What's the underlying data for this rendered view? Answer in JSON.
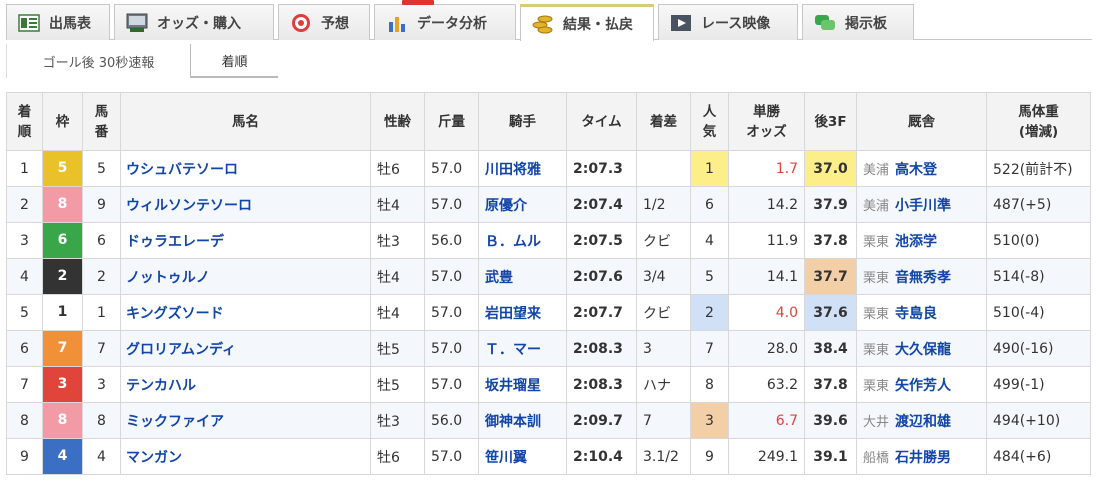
{
  "tabs": [
    {
      "label": "出馬表",
      "icon": "race-card-icon"
    },
    {
      "label": "オッズ・購入",
      "icon": "ipat-terminal-icon"
    },
    {
      "label": "予想",
      "icon": "target-icon"
    },
    {
      "label": "データ分析",
      "icon": "bar-chart-icon"
    },
    {
      "label": "結果・払戻",
      "icon": "coins-icon"
    },
    {
      "label": "レース映像",
      "icon": "video-play-icon"
    },
    {
      "label": "掲示板",
      "icon": "chat-bubble-icon"
    }
  ],
  "subtabs": [
    {
      "label": "ゴール後 30秒速報"
    },
    {
      "label": "着順"
    }
  ],
  "headers": {
    "rank": "着\n順",
    "waku": "枠",
    "umaban": "馬\n番",
    "name": "馬名",
    "sexage": "性齢",
    "weight": "斤量",
    "jockey": "騎手",
    "time": "タイム",
    "margin": "着差",
    "pop": "人\n気",
    "odds": "単勝\nオッズ",
    "last3f": "後3F",
    "trainer": "厩舎",
    "bodyweight": "馬体重\n(増減)"
  },
  "colors": {
    "waku1": "#ffffff",
    "waku2": "#333333",
    "waku3": "#e0443b",
    "waku4": "#3a6fc4",
    "waku5": "#e8c228",
    "waku6": "#3aa64a",
    "waku7": "#f0913a",
    "waku8": "#f29aa6"
  },
  "rows": [
    {
      "rank": "1",
      "waku": "5",
      "umaban": "5",
      "name": "ウシュバテソーロ",
      "sexage": "牡6",
      "weight": "57.0",
      "jockey": "川田将雅",
      "time": "2:07.3",
      "margin": "",
      "pop": "1",
      "odds": "1.7",
      "last3f": "37.0",
      "aff": "美浦",
      "trainer": "高木登",
      "bodyweight": "522(前計不)"
    },
    {
      "rank": "2",
      "waku": "8",
      "umaban": "9",
      "name": "ウィルソンテソーロ",
      "sexage": "牡4",
      "weight": "57.0",
      "jockey": "原優介",
      "time": "2:07.4",
      "margin": "1/2",
      "pop": "6",
      "odds": "14.2",
      "last3f": "37.9",
      "aff": "美浦",
      "trainer": "小手川準",
      "bodyweight": "487(+5)"
    },
    {
      "rank": "3",
      "waku": "6",
      "umaban": "6",
      "name": "ドゥラエレーデ",
      "sexage": "牡3",
      "weight": "56.0",
      "jockey": "Ｂ．ムル",
      "time": "2:07.5",
      "margin": "クビ",
      "pop": "4",
      "odds": "11.9",
      "last3f": "37.8",
      "aff": "栗東",
      "trainer": "池添学",
      "bodyweight": "510(0)"
    },
    {
      "rank": "4",
      "waku": "2",
      "umaban": "2",
      "name": "ノットゥルノ",
      "sexage": "牡4",
      "weight": "57.0",
      "jockey": "武豊",
      "time": "2:07.6",
      "margin": "3/4",
      "pop": "5",
      "odds": "14.1",
      "last3f": "37.7",
      "aff": "栗東",
      "trainer": "音無秀孝",
      "bodyweight": "514(-8)"
    },
    {
      "rank": "5",
      "waku": "1",
      "umaban": "1",
      "name": "キングズソード",
      "sexage": "牡4",
      "weight": "57.0",
      "jockey": "岩田望来",
      "time": "2:07.7",
      "margin": "クビ",
      "pop": "2",
      "odds": "4.0",
      "last3f": "37.6",
      "aff": "栗東",
      "trainer": "寺島良",
      "bodyweight": "510(-4)"
    },
    {
      "rank": "6",
      "waku": "7",
      "umaban": "7",
      "name": "グロリアムンディ",
      "sexage": "牡5",
      "weight": "57.0",
      "jockey": "Ｔ．マー",
      "time": "2:08.3",
      "margin": "3",
      "pop": "7",
      "odds": "28.0",
      "last3f": "38.4",
      "aff": "栗東",
      "trainer": "大久保龍",
      "bodyweight": "490(-16)"
    },
    {
      "rank": "7",
      "waku": "3",
      "umaban": "3",
      "name": "テンカハル",
      "sexage": "牡5",
      "weight": "57.0",
      "jockey": "坂井瑠星",
      "time": "2:08.3",
      "margin": "ハナ",
      "pop": "8",
      "odds": "63.2",
      "last3f": "37.8",
      "aff": "栗東",
      "trainer": "矢作芳人",
      "bodyweight": "499(-1)"
    },
    {
      "rank": "8",
      "waku": "8",
      "umaban": "8",
      "name": "ミックファイア",
      "sexage": "牡3",
      "weight": "56.0",
      "jockey": "御神本訓",
      "time": "2:09.7",
      "margin": "7",
      "pop": "3",
      "odds": "6.7",
      "last3f": "39.6",
      "aff": "大井",
      "trainer": "渡辺和雄",
      "bodyweight": "494(+10)"
    },
    {
      "rank": "9",
      "waku": "4",
      "umaban": "4",
      "name": "マンガン",
      "sexage": "牡6",
      "weight": "57.0",
      "jockey": "笹川翼",
      "time": "2:10.4",
      "margin": "3.1/2",
      "pop": "9",
      "odds": "249.1",
      "last3f": "39.1",
      "aff": "船橋",
      "trainer": "石井勝男",
      "bodyweight": "484(+6)"
    }
  ]
}
